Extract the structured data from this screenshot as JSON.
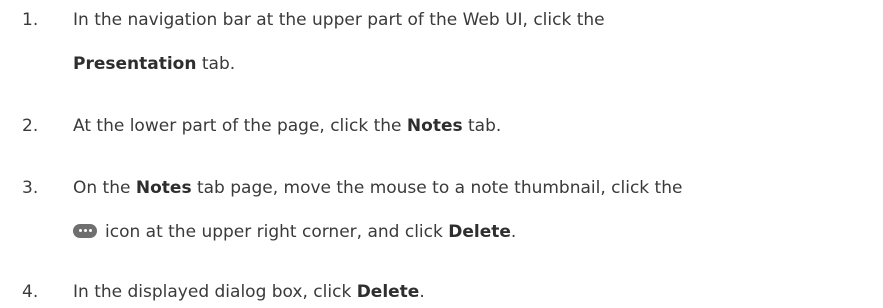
{
  "steps": [
    {
      "number": "1.",
      "lines": [
        {
          "t1": "In the navigation bar at the upper part of the Web UI, click the"
        },
        {
          "b1": "Presentation",
          "t2": " tab."
        }
      ]
    },
    {
      "number": "2.",
      "lines": [
        {
          "t1": "At the lower part of the page, click the ",
          "b1": "Notes",
          "t2": " tab."
        }
      ]
    },
    {
      "number": "3.",
      "lines": [
        {
          "t1": "On the ",
          "b1": "Notes",
          "t2": " tab page, move the mouse to a note thumbnail, click the"
        },
        {
          "t1": "icon at the upper right corner, and click ",
          "b1": "Delete",
          "t2": "."
        }
      ],
      "icon": "more-options-icon"
    },
    {
      "number": "4.",
      "lines": [
        {
          "t1": "In the displayed dialog box, click ",
          "b1": "Delete",
          "t2": "."
        }
      ]
    }
  ]
}
